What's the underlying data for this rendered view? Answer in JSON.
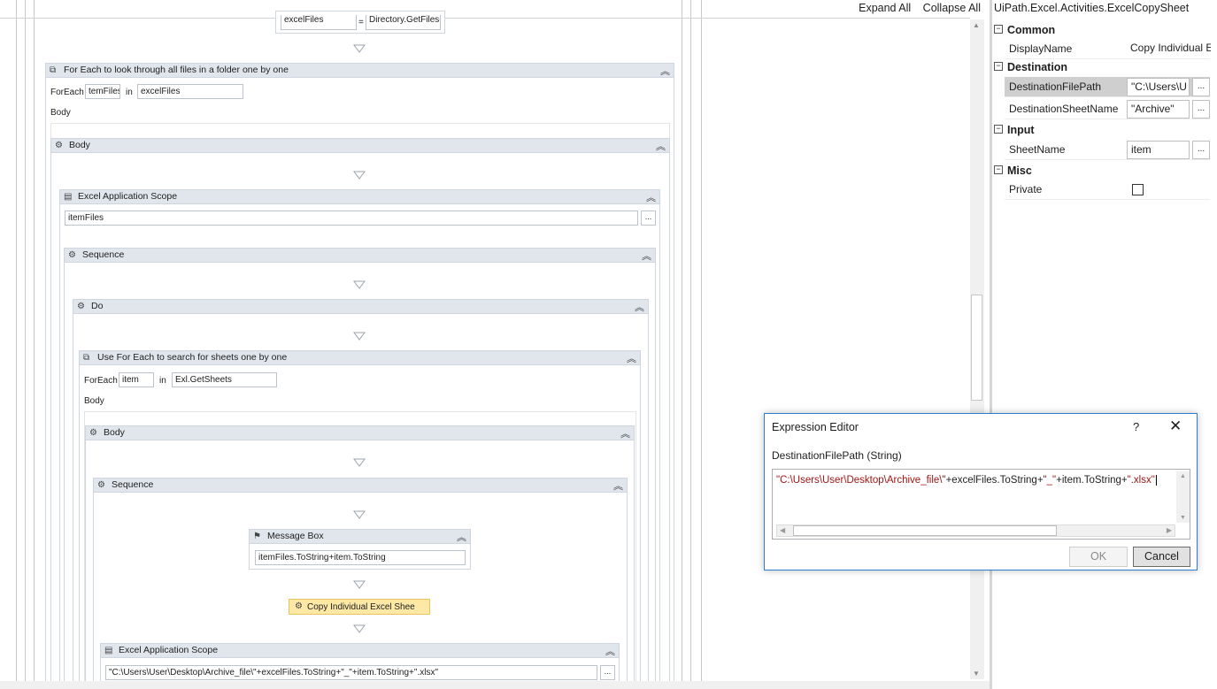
{
  "toolbar": {
    "expand_all": "Expand All",
    "collapse_all": "Collapse All"
  },
  "top_assign": {
    "to": "excelFiles",
    "eq": "=",
    "value": "Directory.GetFiles("
  },
  "foreach_files": {
    "title": "For Each to look through all files in a folder one by one",
    "foreach_label": "ForEach",
    "item_var": "temFiles",
    "in_label": "in",
    "values": "excelFiles",
    "body_label": "Body"
  },
  "body1": {
    "title": "Body"
  },
  "excel_scope1": {
    "title": "Excel Application Scope",
    "path": "itemFiles",
    "dots": "..."
  },
  "sequence1": {
    "title": "Sequence"
  },
  "do": {
    "title": "Do"
  },
  "foreach_sheets": {
    "title": "Use For Each to search for sheets one by one",
    "foreach_label": "ForEach",
    "item_var": "item",
    "in_label": "in",
    "values": "Exl.GetSheets",
    "body_label": "Body"
  },
  "body2": {
    "title": "Body"
  },
  "sequence2": {
    "title": "Sequence"
  },
  "message_box": {
    "title": "Message Box",
    "text": "itemFiles.ToString+item.ToString"
  },
  "copy_sheet": {
    "title": "Copy Individual Excel Shee"
  },
  "excel_scope2": {
    "title": "Excel Application Scope",
    "path": "\"C:\\Users\\User\\Desktop\\Archive_file\\\"+excelFiles.ToString+\"_\"+item.ToString+\".xlsx\"",
    "dots": "..."
  },
  "properties": {
    "title": "UiPath.Excel.Activities.ExcelCopySheet",
    "categories": {
      "common": "Common",
      "destination": "Destination",
      "input": "Input",
      "misc": "Misc"
    },
    "rows": {
      "display_name": {
        "name": "DisplayName",
        "value": "Copy Individual E"
      },
      "dest_file_path": {
        "name": "DestinationFilePath",
        "value": "\"C:\\Users\\U",
        "btn": "..."
      },
      "dest_sheet_name": {
        "name": "DestinationSheetName",
        "value": "\"Archive\"",
        "btn": "..."
      },
      "sheet_name": {
        "name": "SheetName",
        "value": "item",
        "btn": "..."
      },
      "private": {
        "name": "Private"
      }
    }
  },
  "expression_editor": {
    "title": "Expression Editor",
    "help": "?",
    "close": "✕",
    "subtitle": "DestinationFilePath (String)",
    "expression_parts": {
      "p1": "\"C:\\Users\\User\\Desktop\\Archive_file\\\"",
      "p2": "+excelFiles.ToString+",
      "p3": "\"_\"",
      "p4": "+item.ToString+",
      "p5": "\".xlsx\""
    },
    "ok": "OK",
    "cancel": "Cancel"
  },
  "colors": {
    "accent": "#2d7dd2",
    "header_bg": "#e1e6ec",
    "selected_activity": "#fde8a6",
    "string_literal": "#a31515"
  }
}
